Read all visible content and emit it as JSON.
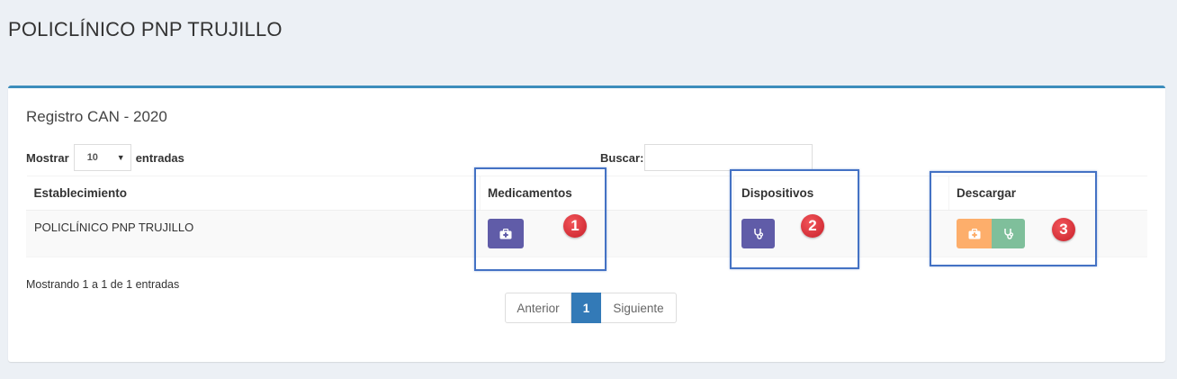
{
  "page": {
    "title": "POLICLÍNICO PNP TRUJILLO"
  },
  "box": {
    "title": "Registro CAN - 2020"
  },
  "length": {
    "prefix": "Mostrar",
    "value": "10",
    "suffix": "entradas"
  },
  "search": {
    "label": "Buscar:",
    "value": ""
  },
  "table": {
    "headers": [
      "Establecimiento",
      "Medicamentos",
      "Dispositivos",
      "Descargar"
    ],
    "rows": [
      {
        "establecimiento": "POLICLÍNICO PNP TRUJILLO"
      }
    ]
  },
  "info": "Mostrando 1 a 1 de 1 entradas",
  "pagination": {
    "prev": "Anterior",
    "current": "1",
    "next": "Siguiente"
  },
  "annotations": {
    "badge1": "1",
    "badge2": "2",
    "badge3": "3"
  },
  "colors": {
    "accent": "#3c8dbc",
    "purple_button": "#605ca8",
    "orange_button": "#fdae6b",
    "green_button": "#7fbf9b",
    "annotation_border": "#4472c4",
    "badge": "#d9262e"
  },
  "icons": {
    "medicamentos": "medkit-icon",
    "dispositivos": "stethoscope-icon"
  }
}
